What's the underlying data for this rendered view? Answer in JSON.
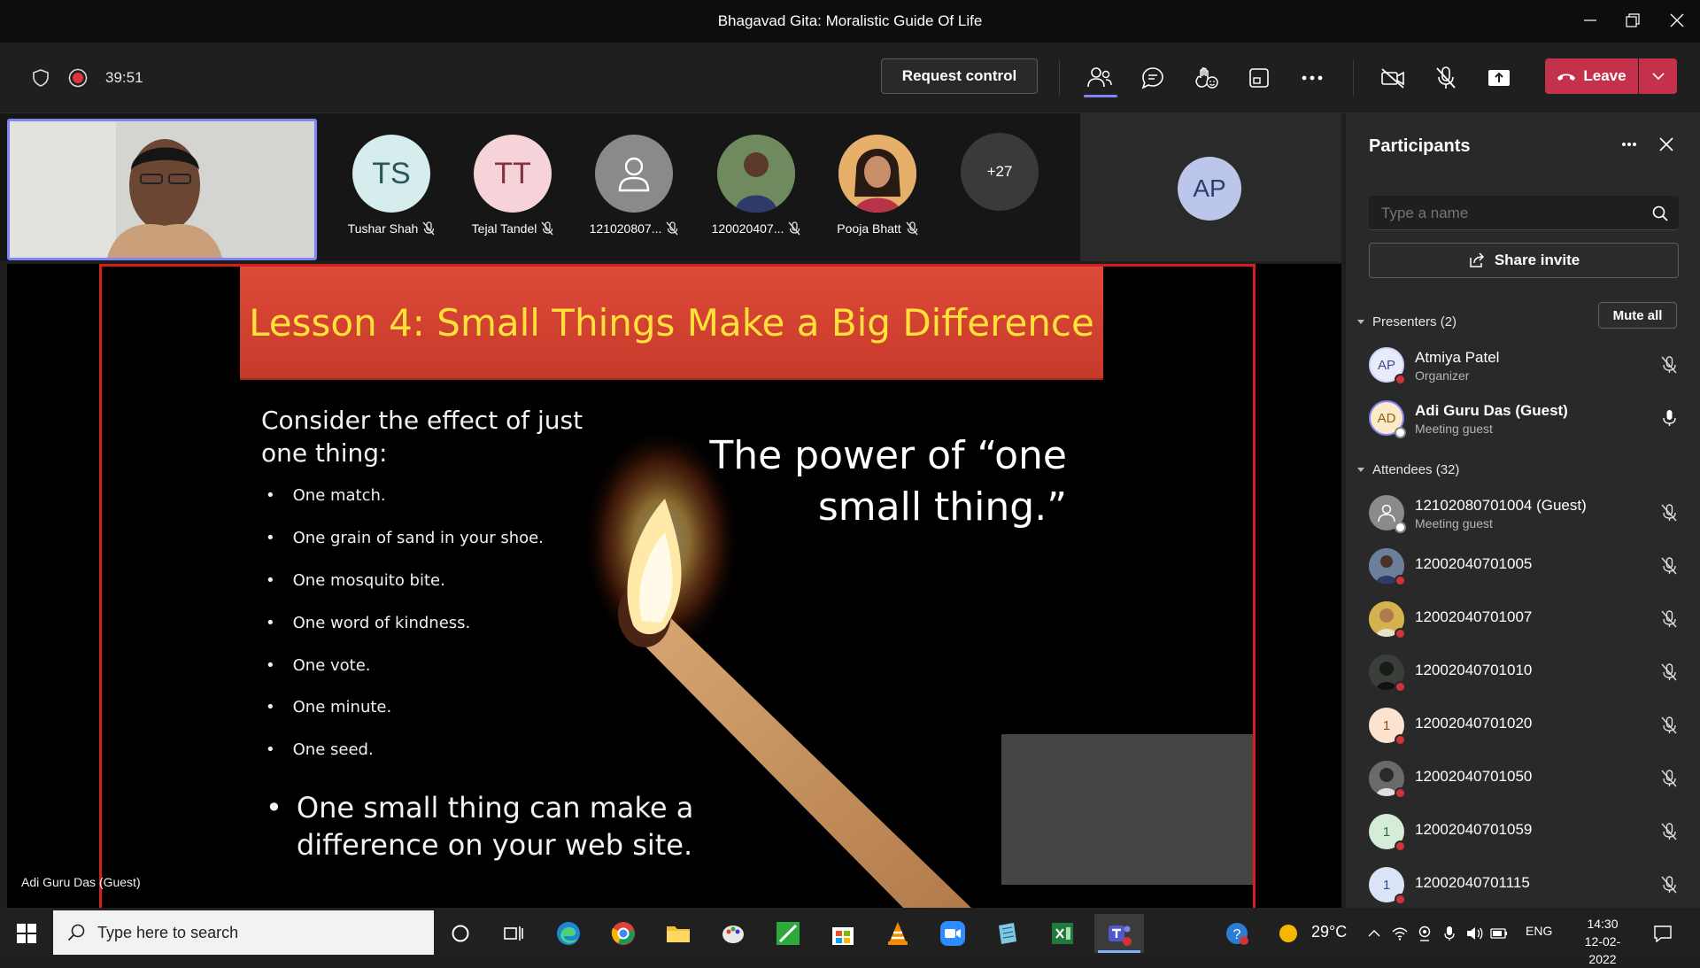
{
  "window": {
    "title": "Bhagavad Gita: Moralistic Guide Of Life"
  },
  "toolbar": {
    "timer": "39:51",
    "request_control": "Request control",
    "leave": "Leave"
  },
  "gallery": {
    "tiles": [
      {
        "initials": "TS",
        "name": "Tushar Shah"
      },
      {
        "initials": "TT",
        "name": "Tejal Tandel"
      },
      {
        "initials": "",
        "name": "121020807..."
      },
      {
        "initials": "",
        "name": "120020407..."
      },
      {
        "initials": "",
        "name": "Pooja Bhatt"
      }
    ],
    "more": "+27",
    "presenter_initials": "AP"
  },
  "slide": {
    "title": "Lesson 4: Small Things Make a Big Difference",
    "intro": "Consider the effect of just one thing:",
    "bullets": [
      "One match.",
      "One grain of sand in your shoe.",
      "One mosquito bite.",
      "One word of kindness.",
      "One vote.",
      "One minute.",
      "One seed."
    ],
    "main_point": "One small thing can make a difference on your web site.",
    "quote": "The power of “one small thing.”"
  },
  "speaker_name": "Adi Guru Das (Guest)",
  "panel": {
    "title": "Participants",
    "search_placeholder": "Type a name",
    "share_invite": "Share invite",
    "presenters_header": "Presenters (2)",
    "mute_all": "Mute all",
    "attendees_header": "Attendees (32)",
    "presenters": [
      {
        "initials": "AP",
        "name": "Atmiya Patel",
        "role": "Organizer"
      },
      {
        "initials": "AD",
        "name": "Adi Guru Das (Guest)",
        "role": "Meeting guest"
      }
    ],
    "attendees": [
      {
        "initials": "",
        "name": "12102080701004 (Guest)",
        "role": "Meeting guest"
      },
      {
        "initials": "",
        "name": "12002040701005",
        "role": ""
      },
      {
        "initials": "",
        "name": "12002040701007",
        "role": ""
      },
      {
        "initials": "",
        "name": "12002040701010",
        "role": ""
      },
      {
        "initials": "1",
        "name": "12002040701020",
        "role": ""
      },
      {
        "initials": "",
        "name": "12002040701050",
        "role": ""
      },
      {
        "initials": "1",
        "name": "12002040701059",
        "role": ""
      },
      {
        "initials": "1",
        "name": "12002040701115",
        "role": ""
      }
    ]
  },
  "taskbar": {
    "search_placeholder": "Type here to search",
    "temperature": "29°C",
    "language": "ENG",
    "time": "14:30",
    "date": "12-02-2022"
  },
  "colors": {
    "leave": "#c4314b",
    "slide_title": "#ffe13a",
    "slide_banner": "#de4a38",
    "self_border": "#7f85f5",
    "presence_busy": "#d13438",
    "presence_offline": "#ffffff"
  }
}
